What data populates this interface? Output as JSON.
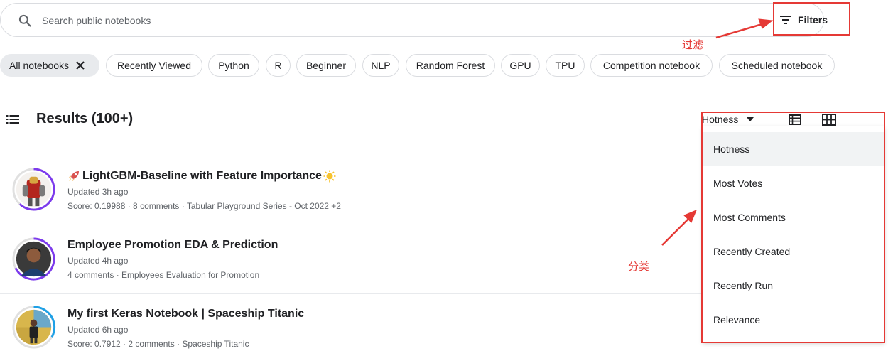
{
  "search": {
    "placeholder": "Search public notebooks",
    "icon": "search-icon",
    "filters_label": "Filters"
  },
  "annotations": {
    "filters_note": "过滤",
    "sort_note": "分类",
    "color": "#e53935"
  },
  "chips": [
    {
      "label": "All notebooks",
      "active": true
    },
    {
      "label": "Recently Viewed"
    },
    {
      "label": "Python"
    },
    {
      "label": "R"
    },
    {
      "label": "Beginner"
    },
    {
      "label": "NLP"
    },
    {
      "label": "Random Forest"
    },
    {
      "label": "GPU"
    },
    {
      "label": "TPU"
    },
    {
      "label": "Competition notebook"
    },
    {
      "label": "Scheduled notebook"
    }
  ],
  "results": {
    "heading": "Results (100+)",
    "sort_selected": "Hotness"
  },
  "notebooks": [
    {
      "title": "LightGBM-Baseline with Feature Importance",
      "updated": "Updated 3h ago",
      "meta": "Score: 0.19988 · 8 comments · Tabular Playground Series - Oct 2022 +2",
      "ring_color": "#7c3aed"
    },
    {
      "title": "Employee Promotion EDA & Prediction",
      "updated": "Updated 4h ago",
      "meta": "4 comments · Employees Evaluation for Promotion",
      "ring_color": "#7c3aed"
    },
    {
      "title": "My first Keras Notebook | Spaceship Titanic",
      "updated": "Updated 6h ago",
      "meta": "Score: 0.7912 · 2 comments · Spaceship Titanic",
      "ring_color": "#1ea0e6"
    }
  ],
  "sort_menu": {
    "items": [
      "Hotness",
      "Most Votes",
      "Most Comments",
      "Recently Created",
      "Recently Run",
      "Relevance"
    ]
  }
}
